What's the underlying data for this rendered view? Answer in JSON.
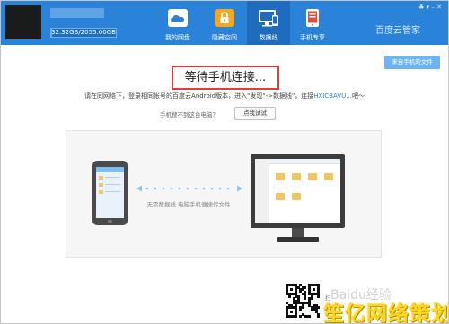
{
  "window": {
    "storage_text": "32.32GB/2055.00GB",
    "storage_fraction": 0.016,
    "brand_text": "百度云管家",
    "window_controls": "♣  ▾  –  ✕"
  },
  "nav": {
    "tabs": [
      {
        "label": "我的网盘",
        "icon": "cloud-icon",
        "active": false
      },
      {
        "label": "隐藏空间",
        "icon": "lock-icon",
        "active": false
      },
      {
        "label": "数据线",
        "icon": "monitor-phone-icon",
        "active": true
      },
      {
        "label": "手机专享",
        "icon": "phone-icon",
        "active": false
      }
    ]
  },
  "main": {
    "template_button": "来自手机的文件",
    "wait_title": "等待手机连接...",
    "instruction_prefix": "请在同网络下，登录相同帐号的百度云Android版本，进入\"发现\"->数据线\"，连接",
    "connection_code": "HXICBAVU...",
    "instruction_suffix": "吧～",
    "prompt_label": "手机搜不到这台电脑？",
    "retry_button": "点我试试",
    "illustration_caption": "无需数据线 电脑手机便捷传文件"
  },
  "footer": {
    "qr_caption": "扫",
    "watermark_ghost": "Baidu经验",
    "watermark_main": "笙亿网络策划"
  },
  "colors": {
    "titlebar": "#2b83d9",
    "active_tab": "#1d6cc0",
    "accent": "#2b83d9",
    "highlight_border": "#e33c3c",
    "watermark": "#ffd51f"
  }
}
